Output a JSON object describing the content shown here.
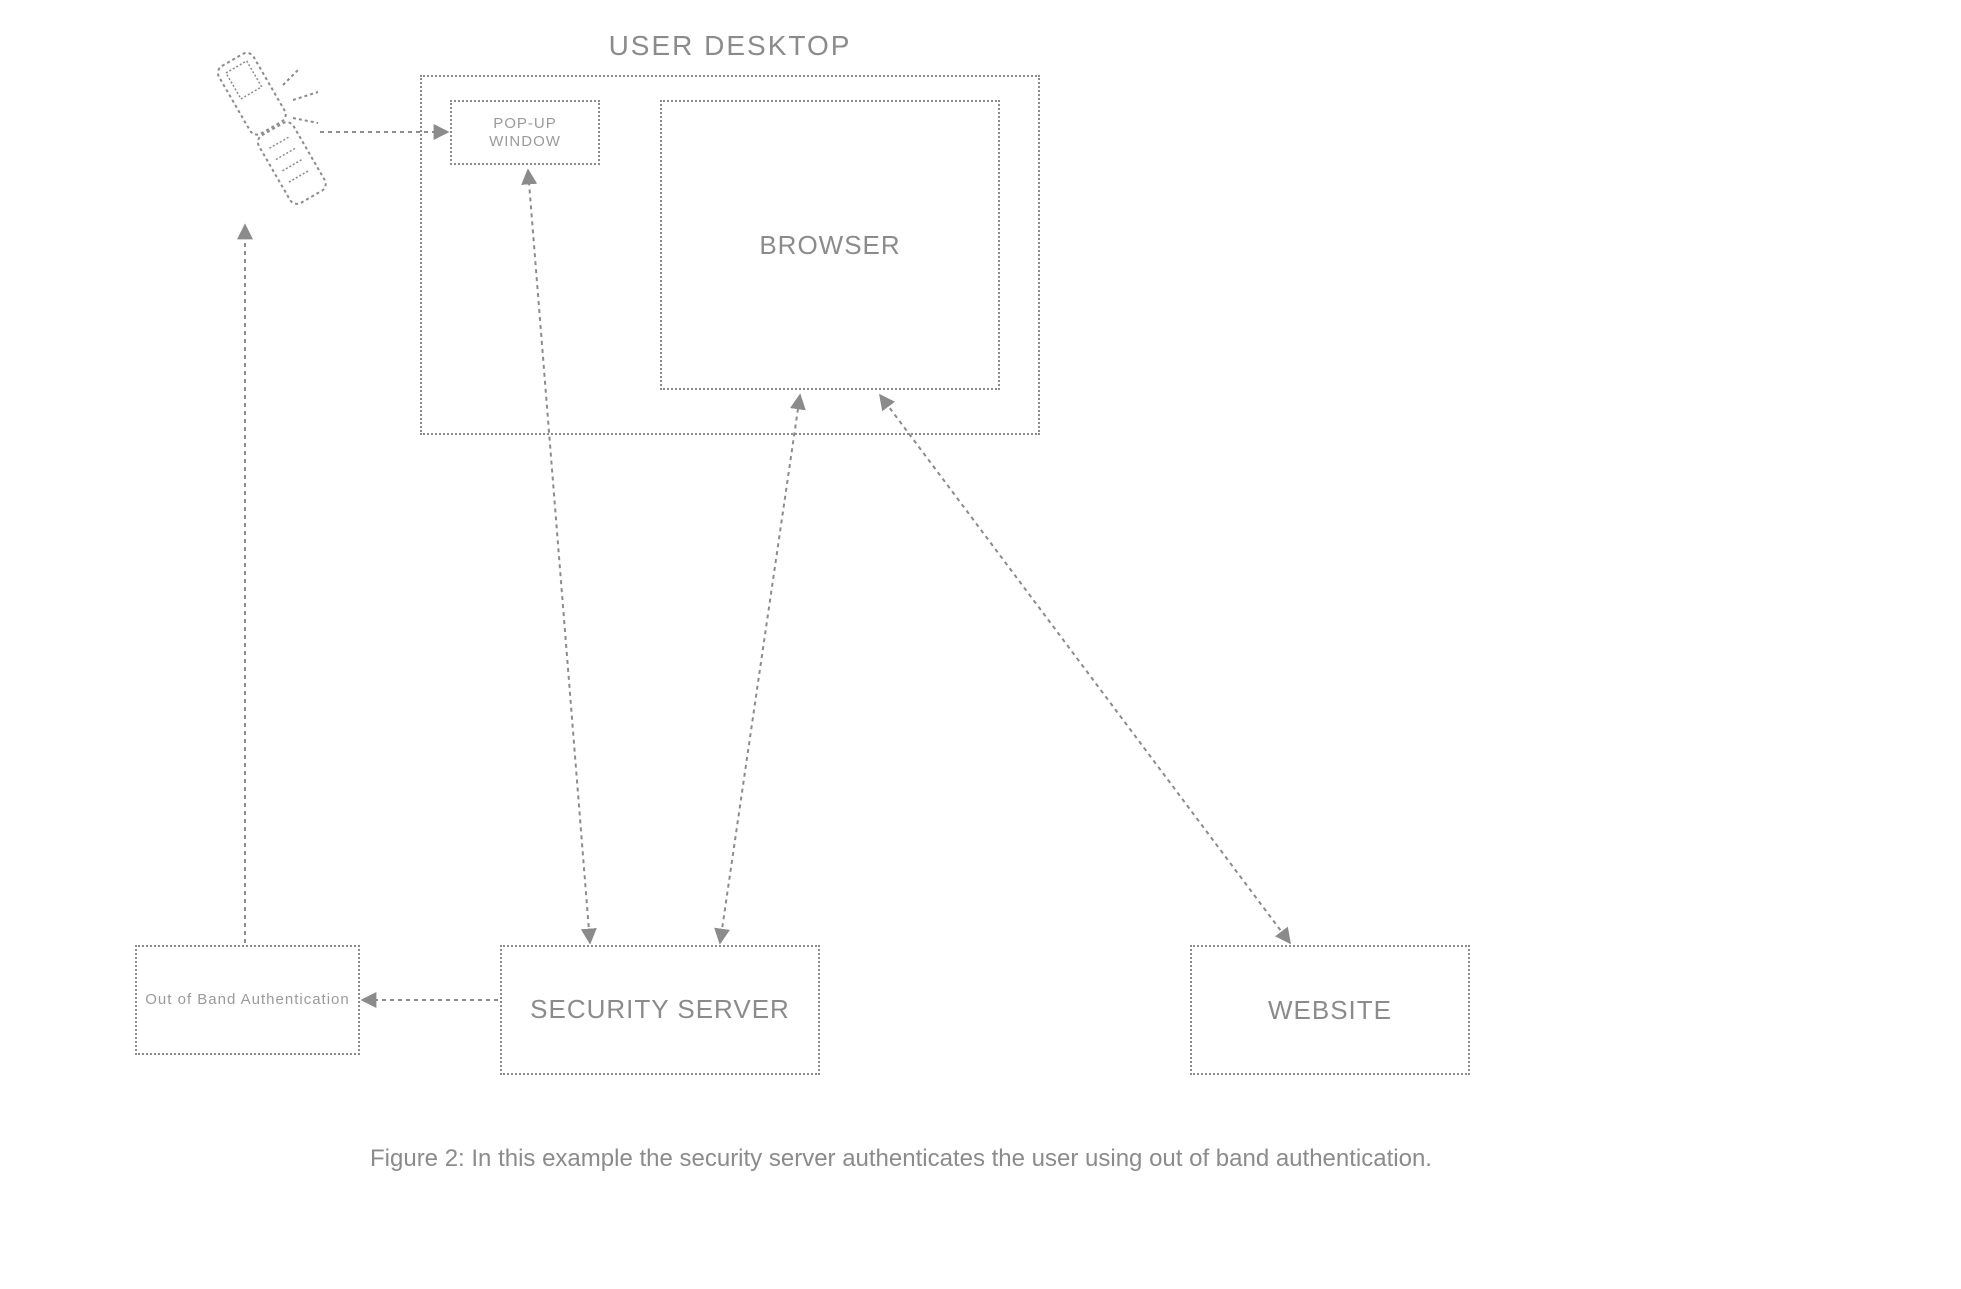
{
  "title": "USER DESKTOP",
  "desktop": {
    "popup_label": "POP-UP WINDOW",
    "browser_label": "BROWSER"
  },
  "security_server_label": "SECURITY SERVER",
  "website_label": "WEBSITE",
  "oob_label": "Out of Band Authentication",
  "caption": "Figure 2: In this example the security server authenticates the user using out of band authentication."
}
